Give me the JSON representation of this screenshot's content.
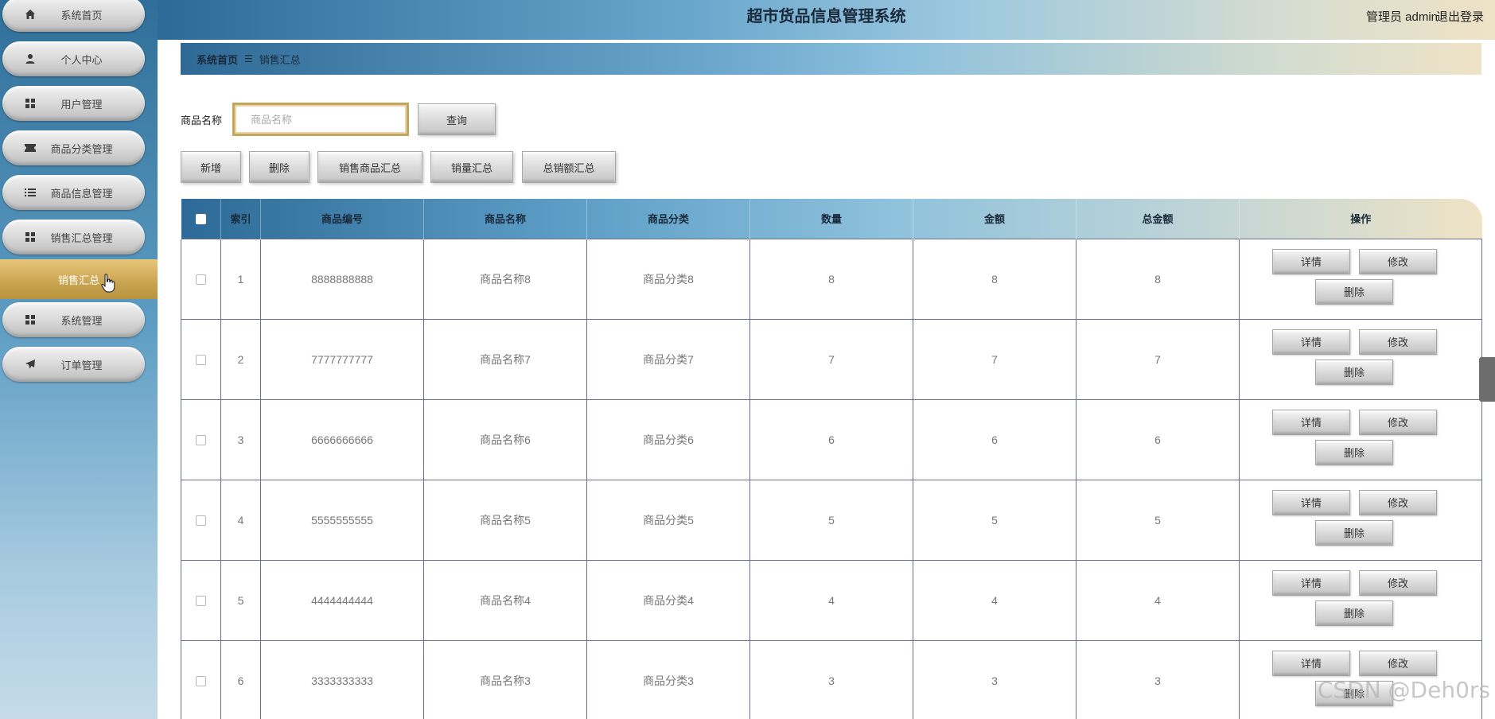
{
  "app": {
    "title": "超市货品信息管理系统",
    "user_text": "管理员 admin",
    "logout_label": "退出登录"
  },
  "sidebar": {
    "items": [
      {
        "label": "系统首页",
        "icon": "home-icon"
      },
      {
        "label": "个人中心",
        "icon": "user-icon"
      },
      {
        "label": "用户管理",
        "icon": "grid-icon"
      },
      {
        "label": "商品分类管理",
        "icon": "ticket-icon"
      },
      {
        "label": "商品信息管理",
        "icon": "list-icon"
      },
      {
        "label": "销售汇总管理",
        "icon": "grid-icon"
      },
      {
        "label": "系统管理",
        "icon": "grid-icon"
      },
      {
        "label": "订单管理",
        "icon": "send-icon"
      }
    ],
    "active_sub": "销售汇总"
  },
  "breadcrumb": {
    "home": "系统首页",
    "sep": "☰",
    "current": "销售汇总"
  },
  "search": {
    "label": "商品名称",
    "placeholder": "商品名称",
    "value": "",
    "button": "查询"
  },
  "toolbar": {
    "add": "新增",
    "delete": "删除",
    "sales_goods_summary": "销售商品汇总",
    "volume_summary": "销量汇总",
    "total_sales_summary": "总销额汇总"
  },
  "table": {
    "headers": [
      "索引",
      "商品编号",
      "商品名称",
      "商品分类",
      "数量",
      "金额",
      "总金额",
      "操作"
    ],
    "rows": [
      {
        "index": "1",
        "code": "8888888888",
        "name": "商品名称8",
        "category": "商品分类8",
        "qty": "8",
        "amount": "8",
        "total": "8"
      },
      {
        "index": "2",
        "code": "7777777777",
        "name": "商品名称7",
        "category": "商品分类7",
        "qty": "7",
        "amount": "7",
        "total": "7"
      },
      {
        "index": "3",
        "code": "6666666666",
        "name": "商品名称6",
        "category": "商品分类6",
        "qty": "6",
        "amount": "6",
        "total": "6"
      },
      {
        "index": "4",
        "code": "5555555555",
        "name": "商品名称5",
        "category": "商品分类5",
        "qty": "5",
        "amount": "5",
        "total": "5"
      },
      {
        "index": "5",
        "code": "4444444444",
        "name": "商品名称4",
        "category": "商品分类4",
        "qty": "4",
        "amount": "4",
        "total": "4"
      },
      {
        "index": "6",
        "code": "3333333333",
        "name": "商品名称3",
        "category": "商品分类3",
        "qty": "3",
        "amount": "3",
        "total": "3"
      }
    ],
    "op_labels": {
      "detail": "详情",
      "edit": "修改",
      "delete": "删除"
    }
  },
  "watermark": "CSDN @Deh0rs"
}
